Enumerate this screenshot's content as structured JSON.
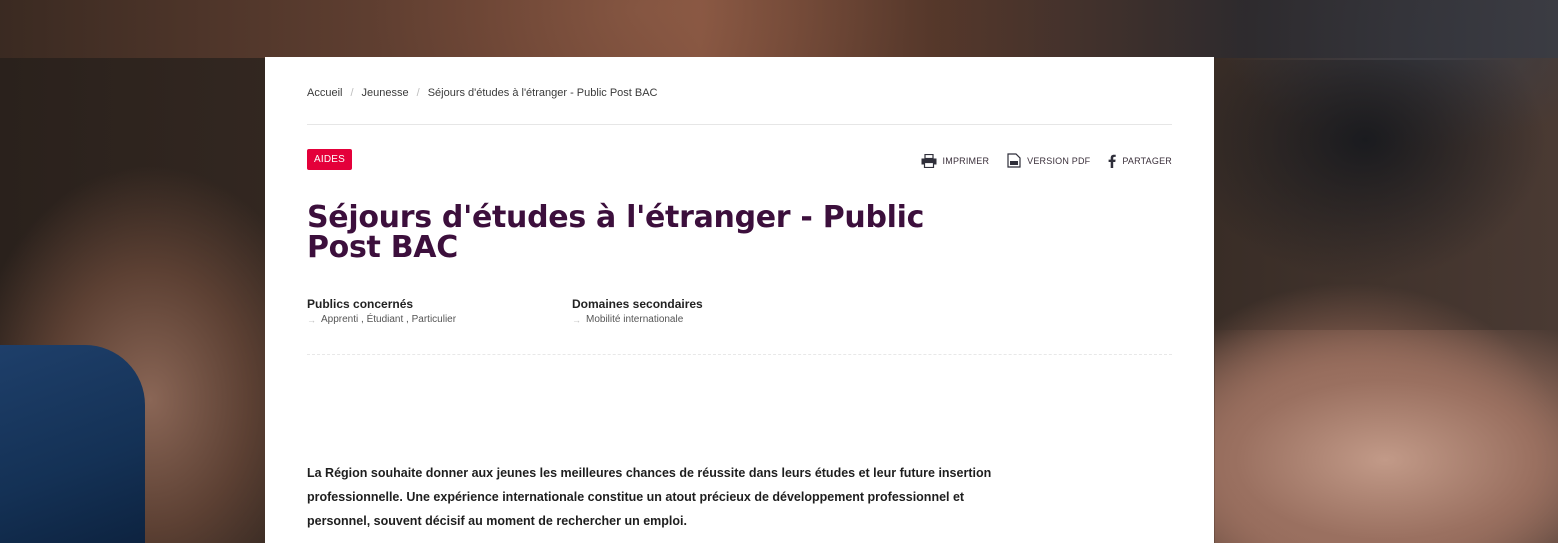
{
  "breadcrumb": {
    "home": "Accueil",
    "section": "Jeunesse",
    "current": "Séjours d'études à l'étranger - Public Post BAC"
  },
  "tag": {
    "label": "AIDES",
    "color": "#e4003a"
  },
  "actions": {
    "print_label": "IMPRIMER",
    "pdf_label": "VERSION PDF",
    "share_label": "PARTAGER"
  },
  "page": {
    "title": "Séjours d'études à l'étranger - Public Post BAC",
    "title_color": "#3c0f3c"
  },
  "meta": {
    "publics": {
      "label": "Publics concernés",
      "value": "Apprenti , Étudiant , Particulier"
    },
    "domaines": {
      "label": "Domaines secondaires",
      "value": "Mobilité internationale"
    }
  },
  "body": {
    "intro": "La Région souhaite donner aux jeunes les meilleures chances de réussite dans leurs études et leur future insertion professionnelle. Une expérience internationale constitue un atout précieux de développement professionnel et personnel, souvent décisif au moment de rechercher un emploi."
  }
}
